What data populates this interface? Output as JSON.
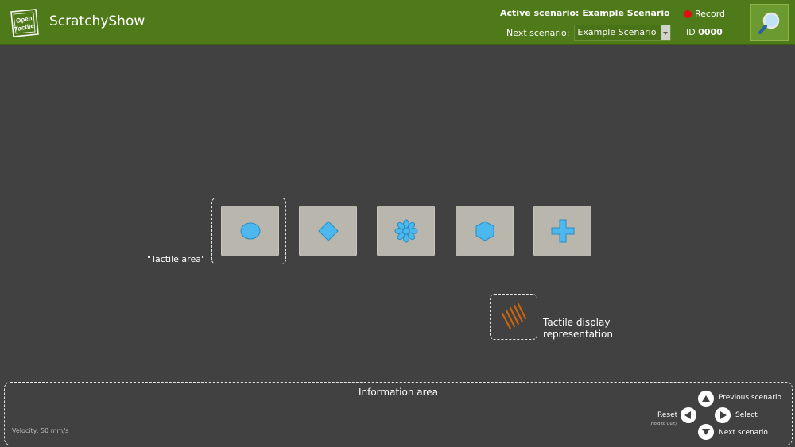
{
  "header": {
    "logo_text": "Open Tactile",
    "app_title": "ScratchyShow",
    "active_scenario_label": "Active scenario:",
    "active_scenario_value": "Example Scenario",
    "next_scenario_label": "Next scenario:",
    "next_scenario_value": "Example Scenario",
    "record_label": "Record",
    "id_label": "ID",
    "id_value": "0000",
    "colors": {
      "bar": "#4f7a1a",
      "record_dot": "#e01010"
    }
  },
  "main": {
    "tiles": [
      {
        "shape": "circle-icon"
      },
      {
        "shape": "diamond-icon"
      },
      {
        "shape": "asterisk-icon"
      },
      {
        "shape": "hexagon-icon"
      },
      {
        "shape": "plus-icon"
      }
    ],
    "tactile_area_label": "\"Tactile area\"",
    "display_label_line1": "Tactile display",
    "display_label_line2": "representation",
    "colors": {
      "shape_fill": "#4db8ee",
      "tile": "#b8b6ad",
      "stripes": "#c9650e"
    }
  },
  "info": {
    "title": "Information area",
    "velocity": "Velocity: 50 mm/s"
  },
  "controls": {
    "previous": "Previous scenario",
    "select": "Select",
    "reset": "Reset",
    "reset_hint": "(Hold to Quit)",
    "next": "Next scenario"
  }
}
